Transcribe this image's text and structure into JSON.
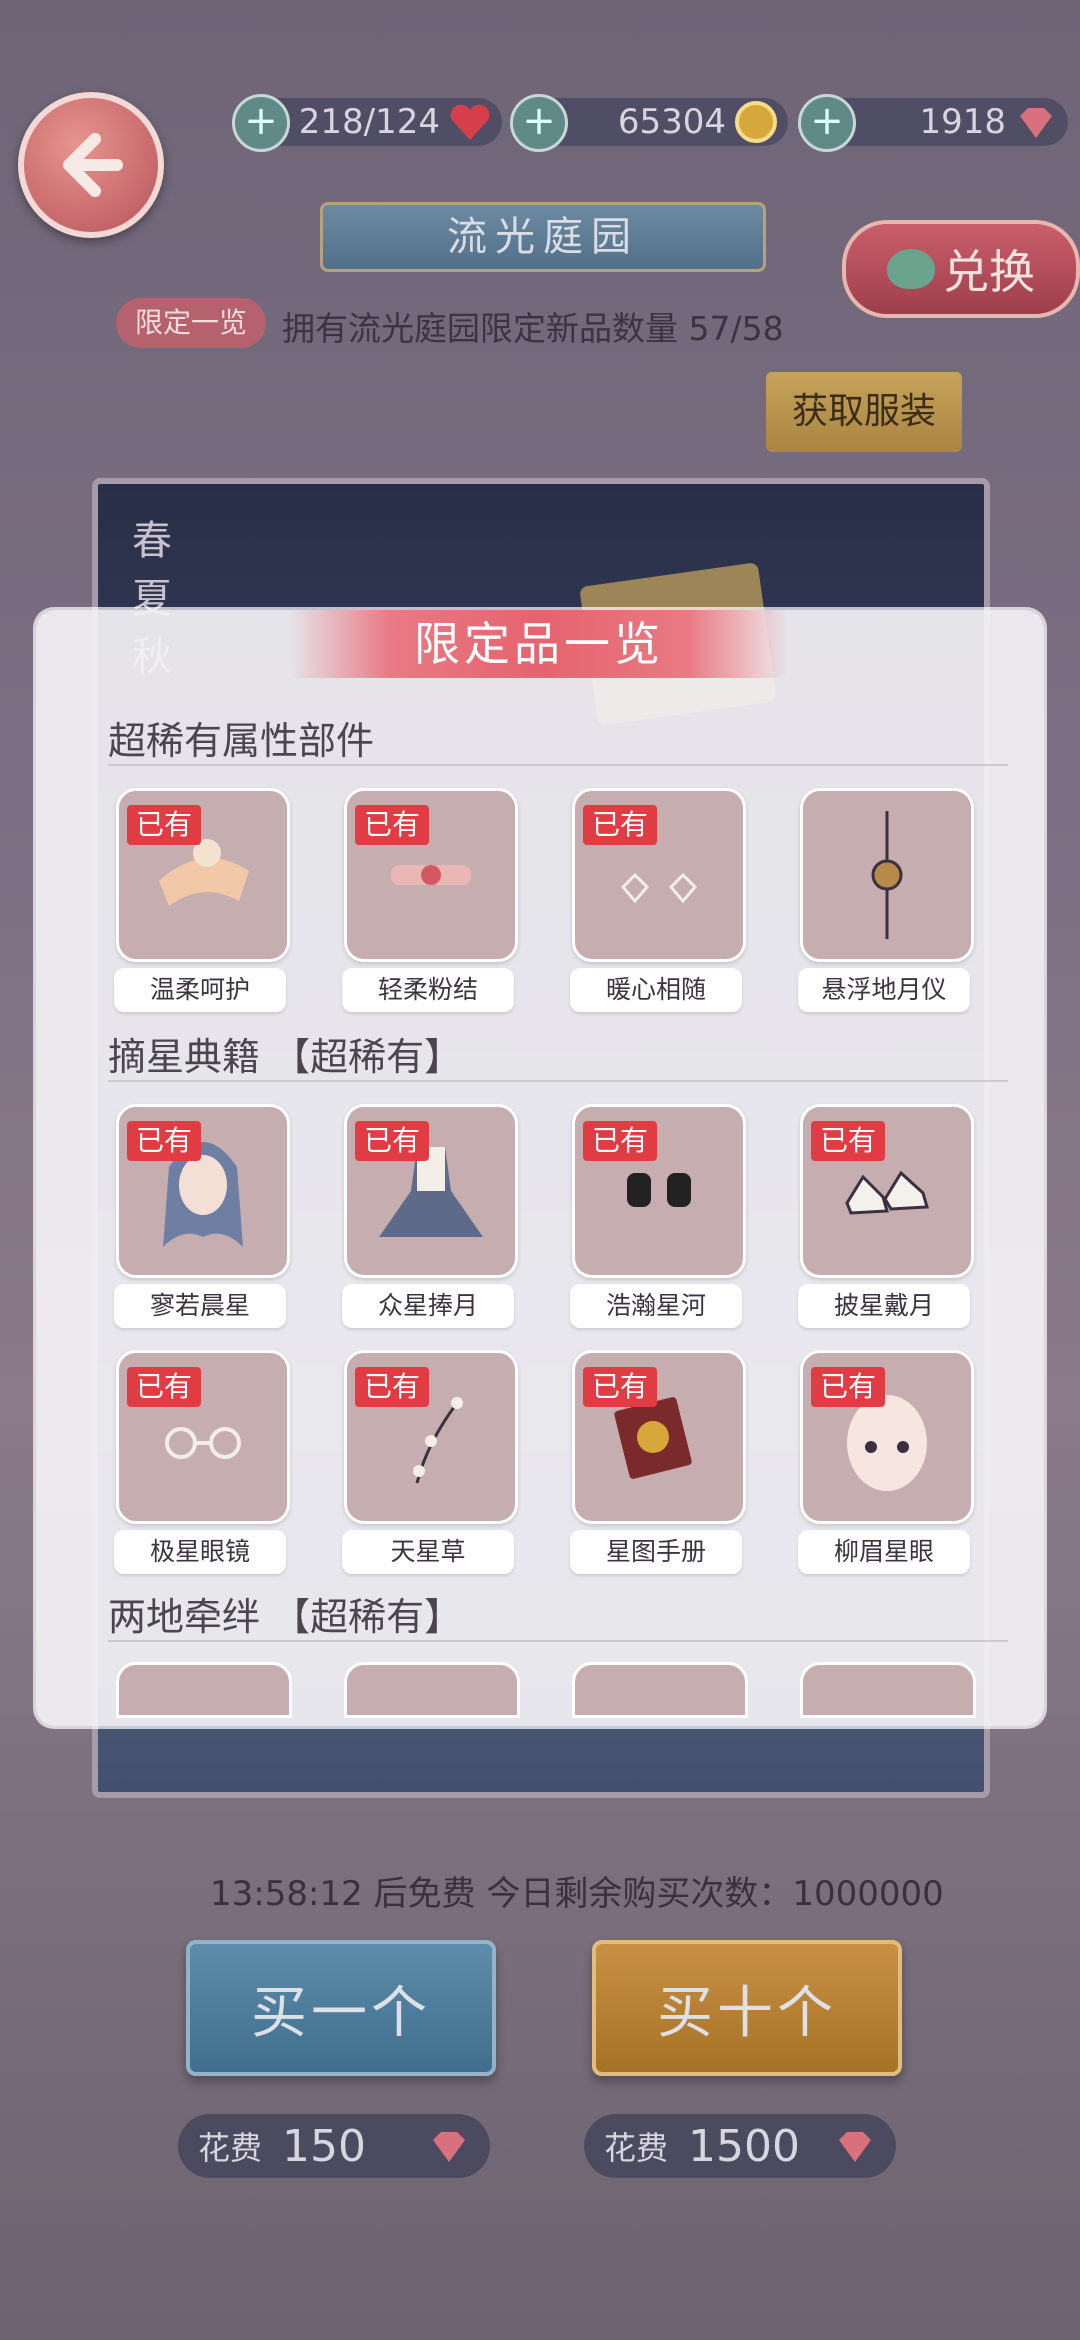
{
  "resources": {
    "stamina": {
      "value": "218/124",
      "icon": "heart-icon"
    },
    "gold": {
      "value": "65304",
      "icon": "coin-icon"
    },
    "diamond": {
      "value": "1918",
      "icon": "diamond-icon"
    }
  },
  "header": {
    "title": "流光庭园",
    "exchange_label": "兑换",
    "limited_tag": "限定一览",
    "limited_text": "拥有流光庭园限定新品数量 57/58",
    "get_clothes": "获取服装"
  },
  "banner": {
    "seasons": [
      "春",
      "夏",
      "秋"
    ]
  },
  "modal": {
    "title": "限定品一览",
    "sections": [
      {
        "title": "超稀有属性部件",
        "items": [
          {
            "name": "温柔呵护",
            "owned": "已有"
          },
          {
            "name": "轻柔粉结",
            "owned": "已有"
          },
          {
            "name": "暖心相随",
            "owned": "已有"
          },
          {
            "name": "悬浮地月仪",
            "owned": ""
          }
        ]
      },
      {
        "title": "摘星典籍 【超稀有】",
        "items": [
          {
            "name": "寥若晨星",
            "owned": "已有"
          },
          {
            "name": "众星捧月",
            "owned": "已有"
          },
          {
            "name": "浩瀚星河",
            "owned": "已有"
          },
          {
            "name": "披星戴月",
            "owned": "已有"
          },
          {
            "name": "极星眼镜",
            "owned": "已有"
          },
          {
            "name": "天星草",
            "owned": "已有"
          },
          {
            "name": "星图手册",
            "owned": "已有"
          },
          {
            "name": "柳眉星眼",
            "owned": "已有"
          }
        ]
      },
      {
        "title": "两地牵绊 【超稀有】",
        "items": []
      }
    ]
  },
  "bottom": {
    "timer_text": "13:58:12 后免费 今日剩余购买次数：1000000",
    "buy_one": "买一个",
    "buy_ten": "买十个",
    "cost_label": "花费",
    "cost_one": "150",
    "cost_ten": "1500"
  },
  "colors": {
    "accent": "#e6636f",
    "owned_badge": "#e13b43",
    "item_bg": "#c6aeb0"
  }
}
